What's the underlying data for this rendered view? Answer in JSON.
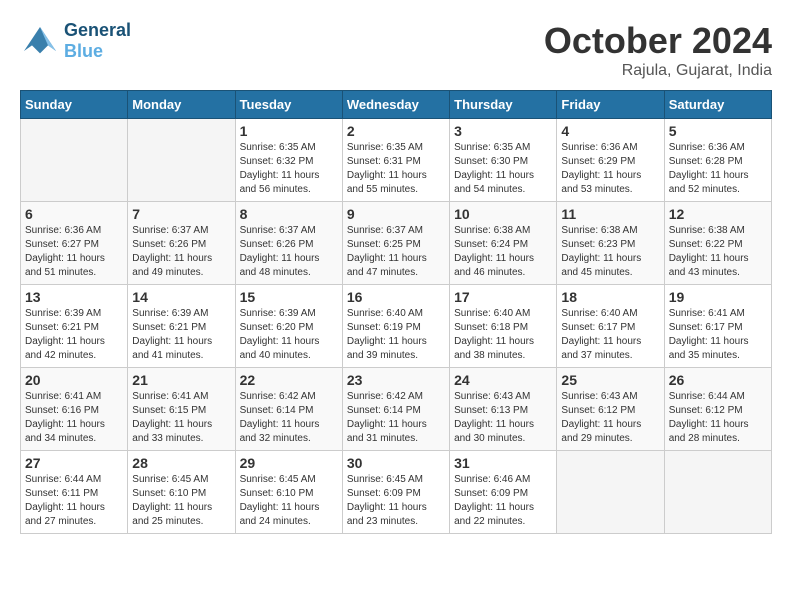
{
  "header": {
    "logo_text1": "General",
    "logo_text2": "Blue",
    "month": "October 2024",
    "location": "Rajula, Gujarat, India"
  },
  "weekdays": [
    "Sunday",
    "Monday",
    "Tuesday",
    "Wednesday",
    "Thursday",
    "Friday",
    "Saturday"
  ],
  "weeks": [
    [
      {
        "day": "",
        "info": ""
      },
      {
        "day": "",
        "info": ""
      },
      {
        "day": "1",
        "info": "Sunrise: 6:35 AM\nSunset: 6:32 PM\nDaylight: 11 hours and 56 minutes."
      },
      {
        "day": "2",
        "info": "Sunrise: 6:35 AM\nSunset: 6:31 PM\nDaylight: 11 hours and 55 minutes."
      },
      {
        "day": "3",
        "info": "Sunrise: 6:35 AM\nSunset: 6:30 PM\nDaylight: 11 hours and 54 minutes."
      },
      {
        "day": "4",
        "info": "Sunrise: 6:36 AM\nSunset: 6:29 PM\nDaylight: 11 hours and 53 minutes."
      },
      {
        "day": "5",
        "info": "Sunrise: 6:36 AM\nSunset: 6:28 PM\nDaylight: 11 hours and 52 minutes."
      }
    ],
    [
      {
        "day": "6",
        "info": "Sunrise: 6:36 AM\nSunset: 6:27 PM\nDaylight: 11 hours and 51 minutes."
      },
      {
        "day": "7",
        "info": "Sunrise: 6:37 AM\nSunset: 6:26 PM\nDaylight: 11 hours and 49 minutes."
      },
      {
        "day": "8",
        "info": "Sunrise: 6:37 AM\nSunset: 6:26 PM\nDaylight: 11 hours and 48 minutes."
      },
      {
        "day": "9",
        "info": "Sunrise: 6:37 AM\nSunset: 6:25 PM\nDaylight: 11 hours and 47 minutes."
      },
      {
        "day": "10",
        "info": "Sunrise: 6:38 AM\nSunset: 6:24 PM\nDaylight: 11 hours and 46 minutes."
      },
      {
        "day": "11",
        "info": "Sunrise: 6:38 AM\nSunset: 6:23 PM\nDaylight: 11 hours and 45 minutes."
      },
      {
        "day": "12",
        "info": "Sunrise: 6:38 AM\nSunset: 6:22 PM\nDaylight: 11 hours and 43 minutes."
      }
    ],
    [
      {
        "day": "13",
        "info": "Sunrise: 6:39 AM\nSunset: 6:21 PM\nDaylight: 11 hours and 42 minutes."
      },
      {
        "day": "14",
        "info": "Sunrise: 6:39 AM\nSunset: 6:21 PM\nDaylight: 11 hours and 41 minutes."
      },
      {
        "day": "15",
        "info": "Sunrise: 6:39 AM\nSunset: 6:20 PM\nDaylight: 11 hours and 40 minutes."
      },
      {
        "day": "16",
        "info": "Sunrise: 6:40 AM\nSunset: 6:19 PM\nDaylight: 11 hours and 39 minutes."
      },
      {
        "day": "17",
        "info": "Sunrise: 6:40 AM\nSunset: 6:18 PM\nDaylight: 11 hours and 38 minutes."
      },
      {
        "day": "18",
        "info": "Sunrise: 6:40 AM\nSunset: 6:17 PM\nDaylight: 11 hours and 37 minutes."
      },
      {
        "day": "19",
        "info": "Sunrise: 6:41 AM\nSunset: 6:17 PM\nDaylight: 11 hours and 35 minutes."
      }
    ],
    [
      {
        "day": "20",
        "info": "Sunrise: 6:41 AM\nSunset: 6:16 PM\nDaylight: 11 hours and 34 minutes."
      },
      {
        "day": "21",
        "info": "Sunrise: 6:41 AM\nSunset: 6:15 PM\nDaylight: 11 hours and 33 minutes."
      },
      {
        "day": "22",
        "info": "Sunrise: 6:42 AM\nSunset: 6:14 PM\nDaylight: 11 hours and 32 minutes."
      },
      {
        "day": "23",
        "info": "Sunrise: 6:42 AM\nSunset: 6:14 PM\nDaylight: 11 hours and 31 minutes."
      },
      {
        "day": "24",
        "info": "Sunrise: 6:43 AM\nSunset: 6:13 PM\nDaylight: 11 hours and 30 minutes."
      },
      {
        "day": "25",
        "info": "Sunrise: 6:43 AM\nSunset: 6:12 PM\nDaylight: 11 hours and 29 minutes."
      },
      {
        "day": "26",
        "info": "Sunrise: 6:44 AM\nSunset: 6:12 PM\nDaylight: 11 hours and 28 minutes."
      }
    ],
    [
      {
        "day": "27",
        "info": "Sunrise: 6:44 AM\nSunset: 6:11 PM\nDaylight: 11 hours and 27 minutes."
      },
      {
        "day": "28",
        "info": "Sunrise: 6:45 AM\nSunset: 6:10 PM\nDaylight: 11 hours and 25 minutes."
      },
      {
        "day": "29",
        "info": "Sunrise: 6:45 AM\nSunset: 6:10 PM\nDaylight: 11 hours and 24 minutes."
      },
      {
        "day": "30",
        "info": "Sunrise: 6:45 AM\nSunset: 6:09 PM\nDaylight: 11 hours and 23 minutes."
      },
      {
        "day": "31",
        "info": "Sunrise: 6:46 AM\nSunset: 6:09 PM\nDaylight: 11 hours and 22 minutes."
      },
      {
        "day": "",
        "info": ""
      },
      {
        "day": "",
        "info": ""
      }
    ]
  ]
}
